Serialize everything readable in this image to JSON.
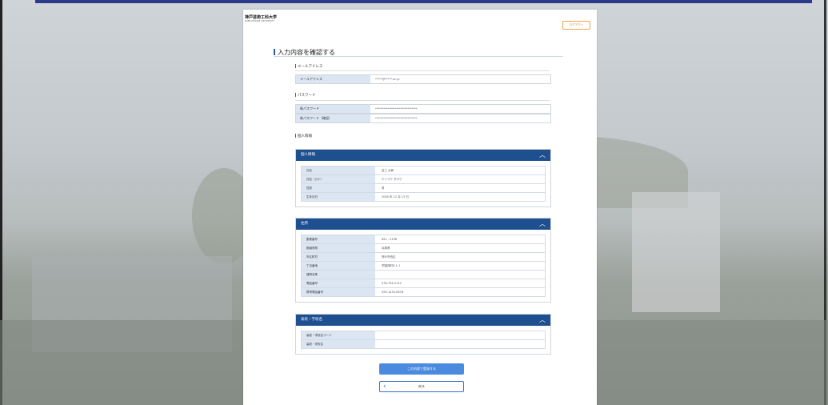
{
  "header": {
    "logo_jp": "神戸芸術工科大学",
    "logo_en": "KOBE DESIGN UNIVERSITY",
    "logout_label": "ログアウト"
  },
  "page_title": "入力内容を確認する",
  "email_section": {
    "title": "メールアドレス",
    "rows": [
      {
        "label": "メールアドレス",
        "value": "*****@*****.ac.jp"
      }
    ]
  },
  "password_section": {
    "title": "パスワード",
    "rows": [
      {
        "label": "新パスワード",
        "value": "******************************"
      },
      {
        "label": "新パスワード（確認）",
        "value": "******************************"
      }
    ]
  },
  "personal_section_title": "個人情報",
  "accordions": [
    {
      "title": "個人情報",
      "rows": [
        {
          "label": "氏名",
          "value": "芸工 太郎"
        },
        {
          "label": "氏名（カナ）",
          "value": "ゲイコウ タロウ"
        },
        {
          "label": "性別",
          "value": "男"
        },
        {
          "label": "生年月日",
          "value": "2000 年 12 月 13 日"
        }
      ]
    },
    {
      "title": "住所",
      "rows": [
        {
          "label": "郵便番号",
          "value": "651 - 2196"
        },
        {
          "label": "都道府県",
          "value": "兵庫県"
        },
        {
          "label": "市区町村",
          "value": "神戸市西区"
        },
        {
          "label": "丁目番地",
          "value": "学園西町8-1-1"
        },
        {
          "label": "建物名等",
          "value": ""
        },
        {
          "label": "電話番号",
          "value": "078-794-2112"
        },
        {
          "label": "携帯電話番号",
          "value": "090-1234-5678"
        }
      ]
    },
    {
      "title": "高校・学校名",
      "rows": [
        {
          "label": "高校・学校名コード",
          "value": ""
        },
        {
          "label": "高校・学校名",
          "value": ""
        }
      ]
    }
  ],
  "buttons": {
    "submit_label": "この内容で登録する",
    "back_label": "戻る"
  },
  "icons": {
    "chevron_up": "chevron-up-icon",
    "chevron_left": "chevron-left-icon"
  }
}
